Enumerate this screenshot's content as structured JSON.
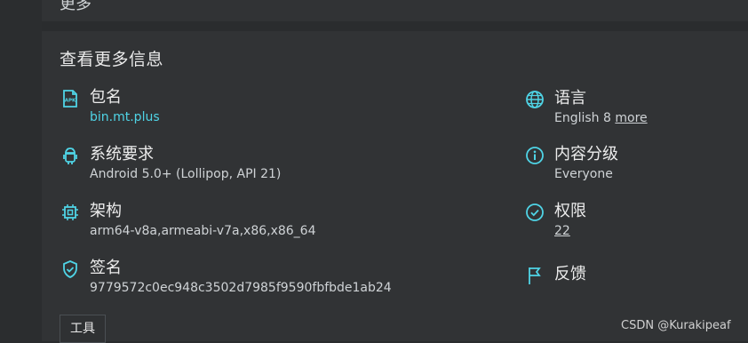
{
  "header": {
    "fragment": "更多"
  },
  "section": {
    "title": "查看更多信息",
    "left": [
      {
        "label": "包名",
        "value": "bin.mt.plus",
        "icon": "apk-icon"
      },
      {
        "label": "系统要求",
        "value": "Android 5.0+ (Lollipop, API 21)",
        "icon": "android-icon"
      },
      {
        "label": "架构",
        "value": "arm64-v8a,armeabi-v7a,x86,x86_64",
        "icon": "chip-icon"
      },
      {
        "label": "签名",
        "value": "9779572c0ec948c3502d7985f9590fbfbde1ab24",
        "icon": "shield-check-icon"
      }
    ],
    "right": [
      {
        "label": "语言",
        "value": "English 8",
        "link": "more",
        "icon": "globe-icon"
      },
      {
        "label": "内容分级",
        "value": "Everyone",
        "icon": "info-icon"
      },
      {
        "label": "权限",
        "link": "22",
        "icon": "check-circle-icon"
      },
      {
        "label": "反馈",
        "icon": "flag-icon"
      }
    ]
  },
  "tools_button": "工具",
  "watermark": "CSDN @Kurakipeaf",
  "colors": {
    "accent": "#4fd4e6",
    "background": "#2a2c2e",
    "card": "#313335"
  }
}
